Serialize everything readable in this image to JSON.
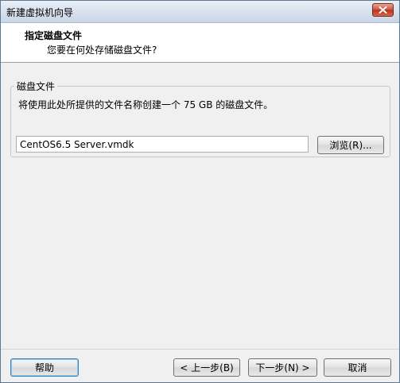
{
  "window": {
    "title": "新建虚拟机向导"
  },
  "header": {
    "title": "指定磁盘文件",
    "subtitle": "您要在何处存储磁盘文件?"
  },
  "disk_file": {
    "group_label": "磁盘文件",
    "description": "将使用此处所提供的文件名称创建一个 75 GB 的磁盘文件。",
    "file_name": "CentOS6.5 Server.vmdk",
    "browse_label": "浏览(R)..."
  },
  "footer": {
    "help_label": "帮助",
    "back_label": "< 上一步(B)",
    "next_label": "下一步(N) >",
    "cancel_label": "取消"
  },
  "colors": {
    "close_button": "#c9533b",
    "header_background": "#ffffff",
    "window_background": "#f0f0f0"
  }
}
